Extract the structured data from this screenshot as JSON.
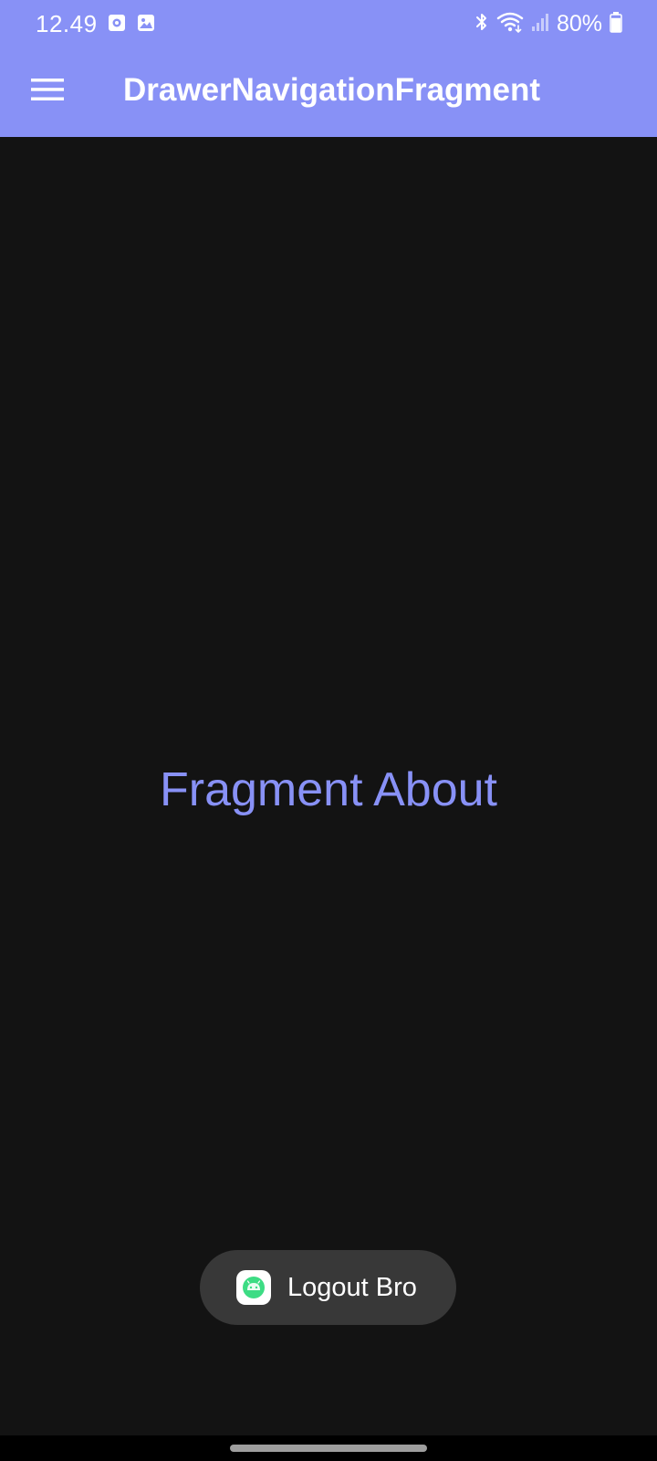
{
  "status_bar": {
    "time": "12.49",
    "notification_icons": [
      "screen-record-icon",
      "gallery-icon"
    ],
    "system_icons": [
      "bluetooth-icon",
      "wifi-icon",
      "signal-icon"
    ],
    "battery_percent_label": "80%",
    "battery_level": 0.8
  },
  "toolbar": {
    "menu_icon": "hamburger-menu-icon",
    "title": "DrawerNavigationFragment"
  },
  "main": {
    "fragment_text": "Fragment About"
  },
  "toast": {
    "icon": "android-app-icon",
    "message": "Logout Bro"
  },
  "colors": {
    "accent": "#8891f6",
    "background": "#131313",
    "toast_background": "#383838",
    "app_icon_green": "#3ddc84"
  }
}
